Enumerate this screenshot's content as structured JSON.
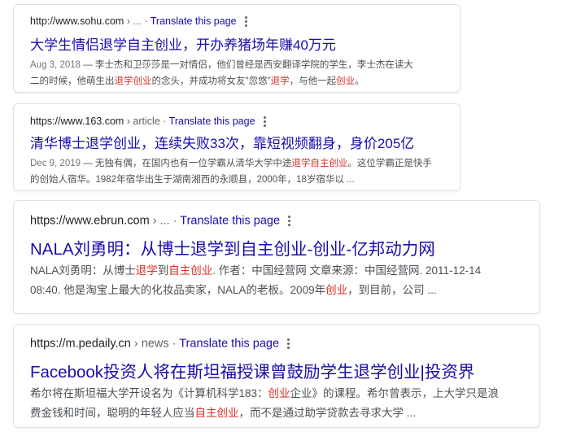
{
  "results": [
    {
      "url": "http://www.sohu.com",
      "breadcrumb": " › ...",
      "translate": "Translate this page",
      "title": "大学生情侣退学自主创业，开办养猪场年赚40万元",
      "snippet": {
        "date": "Aug 3, 2018",
        "sep": " — ",
        "l1": "李士杰和卫莎莎是一对情侣，他们曾经是西安翻译学院的学生，李士杰在读大",
        "l2_a": "二的时候，他萌生出",
        "l2_b": "退学创业",
        "l2_c": "的念头，并成功将女友\"忽悠\"",
        "l2_d": "退学",
        "l2_e": "，与他一起",
        "l2_f": "创业",
        "l2_g": "。"
      }
    },
    {
      "url": "https://www.163.com",
      "breadcrumb": " › article",
      "translate": "Translate this page",
      "title": "清华博士退学创业，连续失败33次，靠短视频翻身，身价205亿",
      "snippet": {
        "date": "Dec 9, 2019",
        "sep": " — ",
        "l1_a": "无独有偶，在国内也有一位学霸从清华大学中途",
        "l1_b": "退学自主创业",
        "l1_c": "。这位学霸正是快手",
        "l2": "的创始人宿华。1982年宿华出生于湖南湘西的永顺县，2000年，18岁宿华以 ..."
      }
    },
    {
      "url": "https://www.ebrun.com",
      "breadcrumb": " › ...",
      "translate": "Translate this page",
      "title": "NALA刘勇明：从博士退学到自主创业-创业-亿邦动力网",
      "snippet": {
        "l1_a": "NALA刘勇明：从博士",
        "l1_b": "退学",
        "l1_c": "到",
        "l1_d": "自主创业",
        "l1_e": ". 作者：中国经营网 文章来源：中国经营网. 2011-12-14",
        "l2_a": "08:40. 他是淘宝上最大的化妆品卖家，NALA的老板。2009年",
        "l2_b": "创业",
        "l2_c": "，到目前，公司 ..."
      }
    },
    {
      "url": "https://m.pedaily.cn",
      "breadcrumb": " › news",
      "translate": "Translate this page",
      "title": "Facebook投资人将在斯坦福授课曾鼓励学生退学创业|投资界",
      "snippet": {
        "l1_a": "希尔将在斯坦福大学开设名为《计算机科学183：",
        "l1_b": "创业",
        "l1_c": "企业》的课程。希尔曾表示，上大学只是浪",
        "l2_a": "费金钱和时间，聪明的年轻人应当",
        "l2_b": "自主创业",
        "l2_c": "，而不是通过助学贷款去寻求大学 ..."
      }
    }
  ]
}
